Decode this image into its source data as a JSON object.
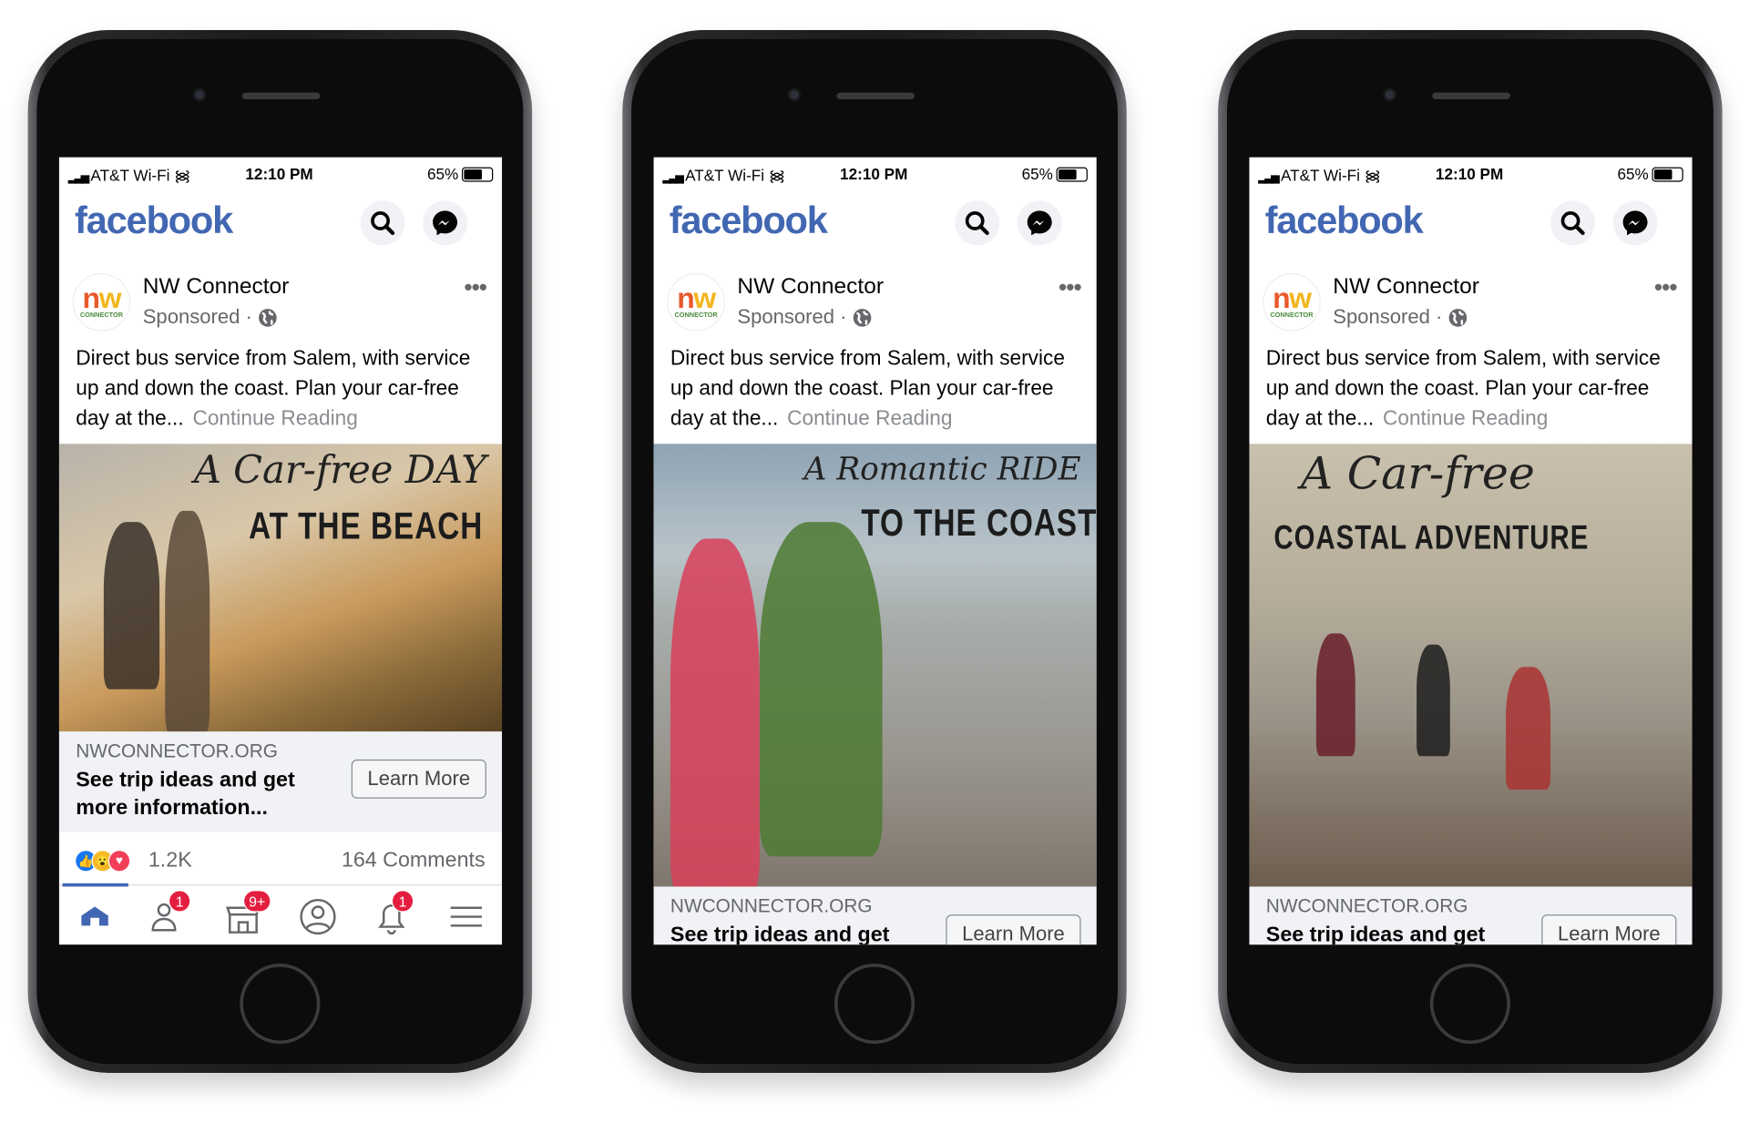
{
  "status_bar": {
    "carrier": "AT&T Wi-Fi",
    "time": "12:10 PM",
    "battery": "65%",
    "battery_level": 0.65
  },
  "app": {
    "logo": "facebook",
    "brand_color": "#4267b2"
  },
  "post": {
    "page_name": "NW Connector",
    "avatar_logo": {
      "letters_n": "n",
      "letters_w": "w",
      "sub": "CONNECTOR"
    },
    "sponsored": "Sponsored",
    "separator": "·",
    "text": "Direct bus service from Salem, with service up and down the coast. Plan your car-free day at the...",
    "continue": "Continue Reading",
    "link_url": "NWCONNECTOR.ORG",
    "link_title": "See trip ideas and get more information...",
    "cta": "Learn More"
  },
  "phones": [
    {
      "ad_line1": "A Car-free DAY",
      "ad_line2": "AT THE BEACH"
    },
    {
      "ad_line1": "A Romantic RIDE",
      "ad_line2": "TO THE COAST"
    },
    {
      "ad_line1": "A Car-free",
      "ad_line2": "COASTAL ADVENTURE"
    }
  ],
  "reactions": {
    "count": "1.2K",
    "comments": "164 Comments",
    "icons": [
      "like-icon",
      "wow-icon",
      "love-icon"
    ]
  },
  "nav": {
    "items": [
      "home",
      "friends",
      "marketplace",
      "profile",
      "notifications",
      "menu"
    ],
    "badges": {
      "friends": "1",
      "marketplace": "9+",
      "notifications": "1"
    }
  }
}
